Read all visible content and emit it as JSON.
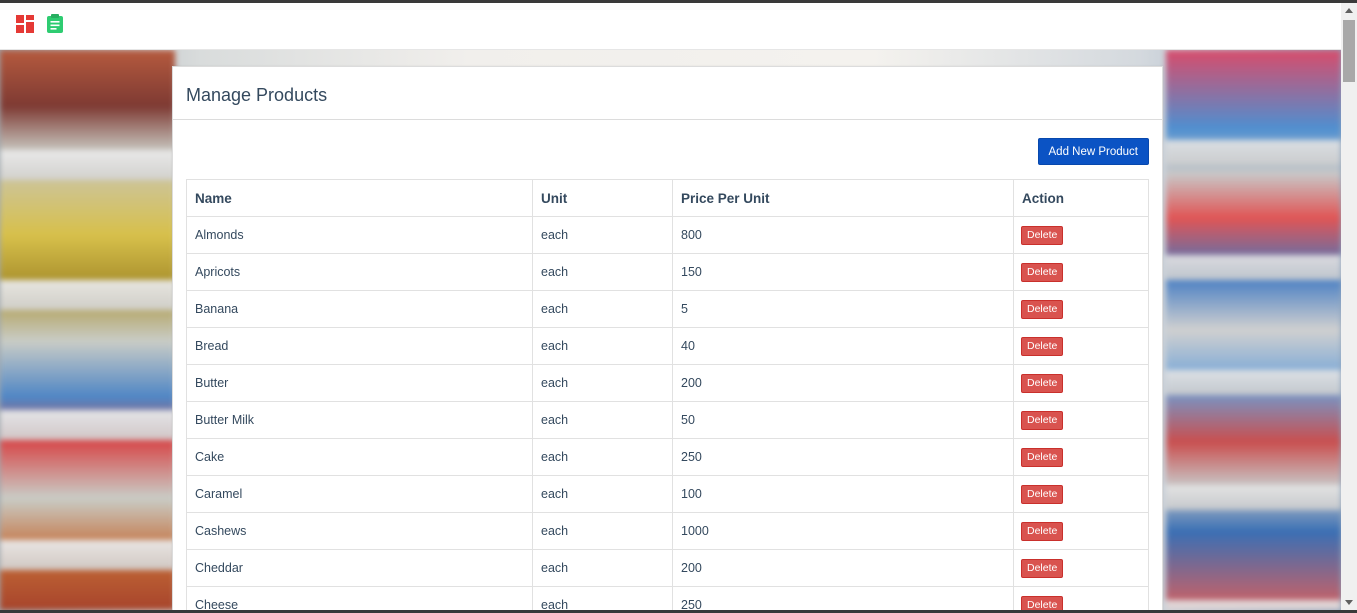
{
  "header": {
    "dashboard_icon": "dashboard-grid-icon",
    "orders_icon": "clipboard-icon"
  },
  "colors": {
    "primary_button": "#0b53c4",
    "delete_button": "#d9534f",
    "text": "#34495e"
  },
  "page": {
    "title": "Manage Products",
    "add_button_label": "Add New Product"
  },
  "table": {
    "columns": [
      "Name",
      "Unit",
      "Price Per Unit",
      "Action"
    ],
    "rows": [
      {
        "name": "Almonds",
        "unit": "each",
        "price": "800",
        "action": "Delete"
      },
      {
        "name": "Apricots",
        "unit": "each",
        "price": "150",
        "action": "Delete"
      },
      {
        "name": "Banana",
        "unit": "each",
        "price": "5",
        "action": "Delete"
      },
      {
        "name": "Bread",
        "unit": "each",
        "price": "40",
        "action": "Delete"
      },
      {
        "name": "Butter",
        "unit": "each",
        "price": "200",
        "action": "Delete"
      },
      {
        "name": "Butter Milk",
        "unit": "each",
        "price": "50",
        "action": "Delete"
      },
      {
        "name": "Cake",
        "unit": "each",
        "price": "250",
        "action": "Delete"
      },
      {
        "name": "Caramel",
        "unit": "each",
        "price": "100",
        "action": "Delete"
      },
      {
        "name": "Cashews",
        "unit": "each",
        "price": "1000",
        "action": "Delete"
      },
      {
        "name": "Cheddar",
        "unit": "each",
        "price": "200",
        "action": "Delete"
      },
      {
        "name": "Cheese",
        "unit": "each",
        "price": "250",
        "action": "Delete"
      }
    ]
  }
}
